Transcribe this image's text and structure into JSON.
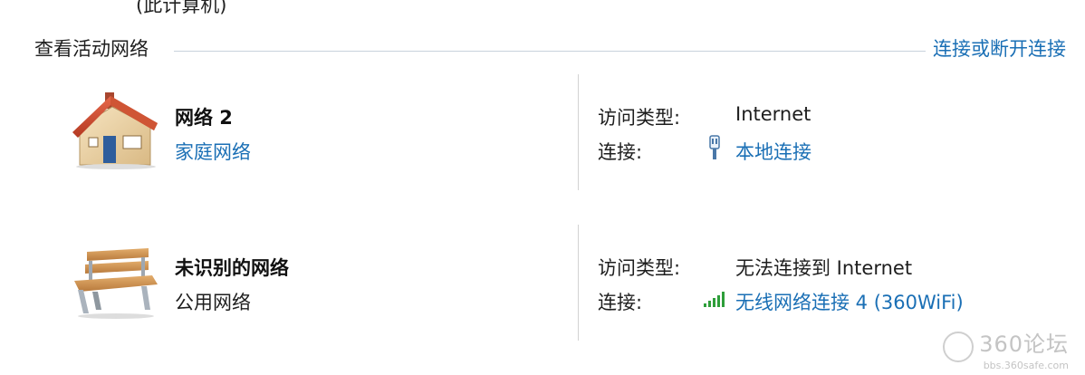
{
  "top_clip": "(此计算机)",
  "section": {
    "title": "查看活动网络",
    "action_link": "连接或断开连接"
  },
  "networks": [
    {
      "name": "网络  2",
      "type": "家庭网络",
      "icon": "home-icon",
      "access_label": "访问类型:",
      "access_value": "Internet",
      "conn_label": "连接:",
      "conn_value": "本地连接",
      "conn_icon": "ethernet-icon"
    },
    {
      "name": "未识别的网络",
      "type": "公用网络",
      "icon": "bench-icon",
      "access_label": "访问类型:",
      "access_value": "无法连接到 Internet",
      "conn_label": "连接:",
      "conn_value": "无线网络连接 4 (360WiFi)",
      "conn_icon": "wifi-signal-icon"
    }
  ],
  "watermark": {
    "main": "360论坛",
    "sub": "bbs.360safe.com"
  },
  "colors": {
    "link": "#1a6fb5",
    "divider": "#d2d2d2",
    "signal": "#2e9e3a"
  }
}
